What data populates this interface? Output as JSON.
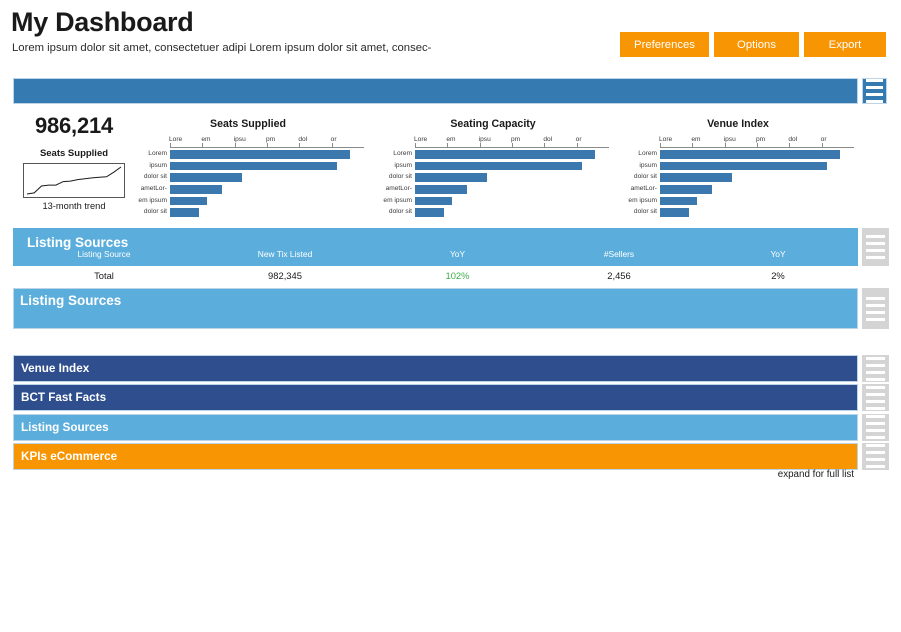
{
  "header": {
    "title": "My Dashboard",
    "subtitle": "Lorem ipsum dolor sit amet, consectetuer adipi Lorem ipsum dolor sit amet, consec-",
    "buttons": [
      {
        "label": "Preferences",
        "name": "preferences-button"
      },
      {
        "label": "Options",
        "name": "options-button"
      },
      {
        "label": "Export",
        "name": "export-button"
      }
    ]
  },
  "kpi": {
    "value": "986,214",
    "label": "Seats Supplied",
    "footnote": "13-month trend",
    "sparkline": [
      2,
      6,
      30,
      33,
      33,
      45,
      47,
      52,
      55,
      58,
      60,
      62,
      78,
      96
    ]
  },
  "charts": [
    {
      "title": "Seats Supplied",
      "tick_labels": [
        "Lore",
        "em",
        "ipsu",
        "pm",
        "dol",
        "or"
      ],
      "categories": [
        "Lorem",
        "ipsum",
        "dolor sit",
        "ametLor-",
        "em ipsum",
        "dolor sit"
      ],
      "values": [
        93,
        86,
        37,
        27,
        19,
        15
      ]
    },
    {
      "title": "Seating Capacity",
      "tick_labels": [
        "Lore",
        "em",
        "ipsu",
        "pm",
        "dol",
        "or"
      ],
      "categories": [
        "Lorem",
        "ipsum",
        "dolor sit",
        "ametLor-",
        "em ipsum",
        "dolor sit"
      ],
      "values": [
        93,
        86,
        37,
        27,
        19,
        15
      ]
    },
    {
      "title": "Venue Index",
      "tick_labels": [
        "Lore",
        "em",
        "ipsu",
        "pm",
        "dol",
        "or"
      ],
      "categories": [
        "Lorem",
        "ipsum",
        "dolor sit",
        "ametLor-",
        "em ipsum",
        "dolor sit"
      ],
      "values": [
        93,
        86,
        37,
        27,
        19,
        15
      ]
    }
  ],
  "chart_data": {
    "type": "bar",
    "title": "Dashboard bar charts",
    "orientation": "horizontal",
    "xlabel": "",
    "ylabel": "",
    "grid": false,
    "legend": false,
    "axis_tick_labels": [
      "Lore",
      "em",
      "ipsu",
      "pm",
      "dol",
      "or"
    ],
    "categories": [
      "Lorem",
      "ipsum",
      "dolor sit",
      "ametLor-",
      "em ipsum",
      "dolor sit"
    ],
    "series": [
      {
        "name": "Seats Supplied",
        "values": [
          93,
          86,
          37,
          27,
          19,
          15
        ]
      },
      {
        "name": "Seating Capacity",
        "values": [
          93,
          86,
          37,
          27,
          19,
          15
        ]
      },
      {
        "name": "Venue Index",
        "values": [
          93,
          86,
          37,
          27,
          19,
          15
        ]
      }
    ],
    "xlim": [
      0,
      100
    ],
    "bar_color": "#3B78AE"
  },
  "table_panel": {
    "title": "Listing Sources",
    "columns": [
      "Listing Source",
      "New Tix Listed",
      "YoY",
      "#Sellers",
      "YoY"
    ],
    "rows": [
      {
        "source": "Total",
        "new_tix_listed": "982,345",
        "yoy_1": "102%",
        "sellers": "2,456",
        "yoy_2": "2%"
      }
    ]
  },
  "band2": {
    "title": "Listing Sources"
  },
  "sections": [
    {
      "label": "Venue Index",
      "color": "#2E4E8E",
      "name": "section-venue-index"
    },
    {
      "label": "BCT Fast Facts",
      "color": "#2E4E8E",
      "name": "section-bct-fast-facts"
    },
    {
      "label": "Listing Sources",
      "color": "#5BAEDC",
      "name": "section-listing-sources"
    },
    {
      "label": "KPIs  eCommerce",
      "color": "#F79502",
      "name": "section-kpis-ecommerce"
    }
  ],
  "footer": {
    "expand_note": "expand for full list"
  },
  "colors": {
    "accent_orange": "#F79502",
    "light_blue": "#5BAEDC",
    "navy": "#2E4E8E",
    "bar_blue": "#3B78AE",
    "header_blue": "#357AB0",
    "positive_green": "#3DAE49",
    "grip_gray": "#D4D4D4"
  }
}
